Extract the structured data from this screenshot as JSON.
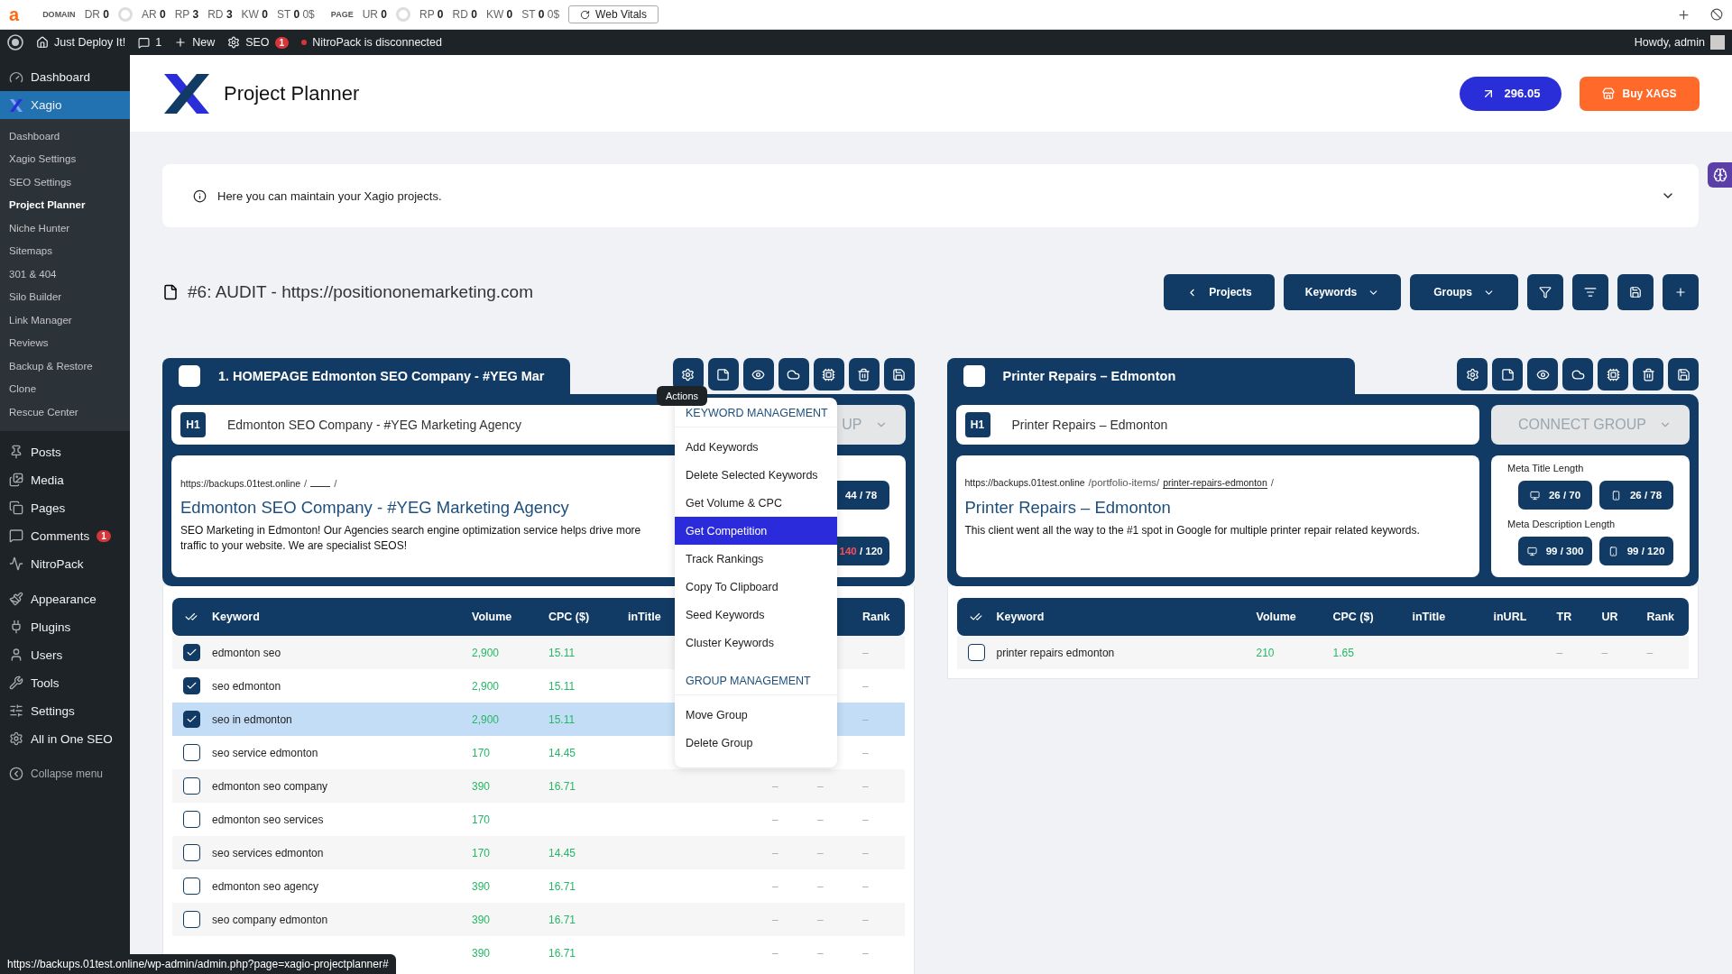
{
  "seo_toolbar": {
    "logo": "a",
    "sections": [
      {
        "label": "DOMAIN",
        "metrics": [
          {
            "kind": "metric",
            "label": "DR",
            "value": "0"
          },
          {
            "kind": "gauge"
          },
          {
            "kind": "metric",
            "label": "AR",
            "value": "0"
          },
          {
            "kind": "metric",
            "label": "RP",
            "value": "3"
          },
          {
            "kind": "metric",
            "label": "RD",
            "value": "3"
          },
          {
            "kind": "metric",
            "label": "KW",
            "value": "0"
          },
          {
            "kind": "metric",
            "label": "ST",
            "value": "0",
            "extra": "0$"
          }
        ]
      },
      {
        "label": "PAGE",
        "metrics": [
          {
            "kind": "metric",
            "label": "UR",
            "value": "0"
          },
          {
            "kind": "gauge"
          },
          {
            "kind": "metric",
            "label": "RP",
            "value": "0"
          },
          {
            "kind": "metric",
            "label": "RD",
            "value": "0"
          },
          {
            "kind": "metric",
            "label": "KW",
            "value": "0"
          },
          {
            "kind": "metric",
            "label": "ST",
            "value": "0",
            "extra": "0$"
          }
        ]
      }
    ],
    "web_vitals": "Web Vitals"
  },
  "admin_bar": {
    "site": "Just Deploy It!",
    "comments": "1",
    "new": "New",
    "seo": "SEO",
    "seo_badge": "1",
    "notice": "NitroPack is disconnected",
    "greeting": "Howdy, admin"
  },
  "sidebar": {
    "sections": [
      {
        "items": [
          {
            "label": "Dashboard",
            "selected": false
          },
          {
            "label": "Xagio",
            "selected": true,
            "children": [
              {
                "label": "Dashboard",
                "selected": false
              },
              {
                "label": "Xagio Settings",
                "selected": false
              },
              {
                "label": "SEO Settings",
                "selected": false
              },
              {
                "label": "Project Planner",
                "selected": true
              },
              {
                "label": "Niche Hunter",
                "selected": false
              },
              {
                "label": "Sitemaps",
                "selected": false
              },
              {
                "label": "301 & 404",
                "selected": false
              },
              {
                "label": "Silo Builder",
                "selected": false
              },
              {
                "label": "Link Manager",
                "selected": false
              },
              {
                "label": "Reviews",
                "selected": false
              },
              {
                "label": "Backup & Restore",
                "selected": false
              },
              {
                "label": "Clone",
                "selected": false
              },
              {
                "label": "Rescue Center",
                "selected": false
              }
            ]
          }
        ]
      },
      {
        "items": [
          {
            "label": "Posts",
            "selected": false
          },
          {
            "label": "Media",
            "selected": false
          },
          {
            "label": "Pages",
            "selected": false
          },
          {
            "label": "Comments",
            "selected": false,
            "badge": "1"
          },
          {
            "label": "NitroPack",
            "selected": false
          }
        ]
      },
      {
        "items": [
          {
            "label": "Appearance",
            "selected": false
          },
          {
            "label": "Plugins",
            "selected": false
          },
          {
            "label": "Users",
            "selected": false
          },
          {
            "label": "Tools",
            "selected": false
          },
          {
            "label": "Settings",
            "selected": false
          },
          {
            "label": "All in One SEO",
            "selected": false
          }
        ]
      }
    ],
    "collapse": "Collapse menu"
  },
  "header": {
    "title": "Project Planner",
    "credits": "296.05",
    "buy": "Buy XAGS"
  },
  "info": {
    "text": "Here you can maintain your Xagio projects.",
    "expanded": false
  },
  "project": {
    "title": "#6: AUDIT - https://positiononemarketing.com",
    "buttons": [
      {
        "kind": "back",
        "label": "Projects"
      },
      {
        "kind": "dropdown",
        "label": "Keywords"
      },
      {
        "kind": "dropdown",
        "label": "Groups"
      },
      {
        "kind": "icon"
      },
      {
        "kind": "icon"
      },
      {
        "kind": "icon"
      },
      {
        "kind": "icon"
      }
    ]
  },
  "groups": [
    {
      "title": "1. HOMEPAGE Edmonton SEO Company - #YEG Mar",
      "checked": false,
      "h1_tag": "H1",
      "h1": "Edmonton SEO Company - #YEG Marketing Agency",
      "connect": "UP",
      "url": {
        "domain": "https://backups.01test.online",
        "path": "/",
        "end": "/"
      },
      "page_title": "Edmonton SEO Company - #YEG Marketing Agency",
      "description": "SEO Marketing in Edmonton! Our Agencies search engine optimization service helps drive more traffic to your website. We are specialist SEOS!",
      "meta": {
        "title_pills": [
          {
            "value": "44",
            "limit": "/ 78",
            "over": false
          }
        ],
        "description_pills": [
          {
            "value": "140",
            "limit": "/ 120",
            "over": true
          }
        ]
      },
      "menu": {
        "tooltip": "Actions",
        "items": [
          {
            "kind": "heading",
            "label": "KEYWORD MANAGEMENT"
          },
          {
            "kind": "item",
            "label": "Add Keywords",
            "selected": false
          },
          {
            "kind": "item",
            "label": "Delete Selected Keywords",
            "selected": false
          },
          {
            "kind": "item",
            "label": "Get Volume & CPC",
            "selected": false
          },
          {
            "kind": "item",
            "label": "Get Competition",
            "selected": true
          },
          {
            "kind": "item",
            "label": "Track Rankings",
            "selected": false
          },
          {
            "kind": "item",
            "label": "Copy To Clipboard",
            "selected": false
          },
          {
            "kind": "item",
            "label": "Seed Keywords",
            "selected": false
          },
          {
            "kind": "item",
            "label": "Cluster Keywords",
            "selected": false
          },
          {
            "kind": "heading",
            "label": "GROUP MANAGEMENT"
          },
          {
            "kind": "item",
            "label": "Move Group",
            "selected": false
          },
          {
            "kind": "item",
            "label": "Delete Group",
            "selected": false
          }
        ]
      },
      "table": {
        "columns": [
          "Keyword",
          "Volume",
          "CPC ($)",
          "inTitle"
        ],
        "end_column": "Rank",
        "rows": [
          {
            "keyword": "edmonton seo",
            "volume": "2,900",
            "cpc": "15.11",
            "rank": "–",
            "checked": true,
            "selected": false
          },
          {
            "keyword": "seo edmonton",
            "volume": "2,900",
            "cpc": "15.11",
            "rank": "–",
            "checked": true,
            "selected": false
          },
          {
            "keyword": "seo in edmonton",
            "volume": "2,900",
            "cpc": "15.11",
            "rank": "–",
            "checked": true,
            "selected": true
          },
          {
            "keyword": "seo service edmonton",
            "volume": "170",
            "cpc": "14.45",
            "rank": "–",
            "checked": false,
            "selected": false
          },
          {
            "keyword": "edmonton seo company",
            "volume": "390",
            "cpc": "16.71",
            "tr": "–",
            "ur": "–",
            "rank": "–",
            "checked": false,
            "selected": false
          },
          {
            "keyword": "edmonton seo services",
            "volume": "170",
            "tr": "–",
            "ur": "–",
            "rank": "–",
            "checked": false,
            "selected": false
          },
          {
            "keyword": "seo services edmonton",
            "volume": "170",
            "cpc": "14.45",
            "tr": "–",
            "ur": "–",
            "rank": "–",
            "checked": false,
            "selected": false
          },
          {
            "keyword": "edmonton seo agency",
            "volume": "390",
            "cpc": "16.71",
            "tr": "–",
            "ur": "–",
            "rank": "–",
            "checked": false,
            "selected": false
          },
          {
            "keyword": "seo company edmonton",
            "volume": "390",
            "cpc": "16.71",
            "tr": "–",
            "ur": "–",
            "rank": "–",
            "checked": false,
            "selected": false
          },
          {
            "volume": "390",
            "cpc": "16.71",
            "tr": "–",
            "ur": "–",
            "rank": "–",
            "selected": false
          }
        ]
      }
    },
    {
      "title": "Printer Repairs – Edmonton",
      "checked": false,
      "h1_tag": "H1",
      "h1": "Printer Repairs – Edmonton",
      "connect": "CONNECT GROUP",
      "url": {
        "domain": "https://backups.01test.online",
        "path": "/portfolio-items/",
        "slug": "printer-repairs-edmonton",
        "end": "/"
      },
      "page_title": "Printer Repairs – Edmonton",
      "description": "This client went all the way to the #1 spot in Google for multiple printer repair related keywords.",
      "meta": {
        "title_label": "Meta Title Length",
        "title_pills": [
          {
            "kind": "desktop",
            "value": "26",
            "limit": "/ 70",
            "over": false
          },
          {
            "kind": "mobile",
            "value": "26",
            "limit": "/ 78",
            "over": false
          }
        ],
        "description_label": "Meta Description Length",
        "description_pills": [
          {
            "kind": "desktop",
            "value": "99",
            "limit": "/ 300",
            "over": false
          },
          {
            "kind": "mobile",
            "value": "99",
            "limit": "/ 120",
            "over": false
          }
        ]
      },
      "table": {
        "columns": [
          "Keyword",
          "Volume",
          "CPC ($)",
          "inTitle",
          "inURL",
          "TR",
          "UR"
        ],
        "end_column": "Rank",
        "rows": [
          {
            "keyword": "printer repairs edmonton",
            "volume": "210",
            "cpc": "1.65",
            "tr": "–",
            "ur": "–",
            "rank": "–",
            "checked": false,
            "selected": false
          }
        ]
      }
    }
  ],
  "status_url": "https://backups.01test.online/wp-admin/admin.php?page=xagio-projectplanner#"
}
